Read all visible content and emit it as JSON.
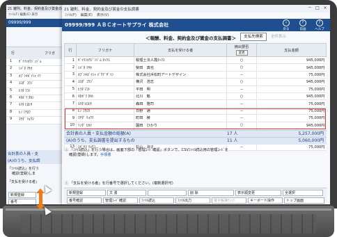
{
  "back_window": {
    "title": "21 雑則、料金、契約金及び賞金の支払調書",
    "menu": "ﾌｧｲﾙ(F)  編集(E)  表示",
    "company_code": "09999/999",
    "col_row": "行",
    "col_kana": "フリガ",
    "sum_label": "合計表の人員・支",
    "sum_label2": "(A)のうち、支払調",
    "note1": "「ﾌｧｲﾙ読込」を行う",
    "note1b": "確認(登録)しま",
    "note2": "「支払を受ける者」",
    "rows": [
      {
        "no": "1",
        "kana": "ｾﾞｲﾘｼﾎｳｼﾞﾝｼﾞﾑ"
      },
      {
        "no": "2",
        "kana": "ｼﾊﾞﾀ ﾏｻｵ"
      },
      {
        "no": "3",
        "kana": "ｶﾌﾞｼｷｶﾞｲｼｬ ｲﾜ"
      },
      {
        "no": "4",
        "kana": "ﾖｺﾀﾞ ｺｳｼﾞ"
      },
      {
        "no": "5",
        "kana": "ﾋﾗﾀ ﾏｺﾄ"
      },
      {
        "no": "6",
        "kana": "ｷﾀｶﾞﾜ ﾀｶｼ"
      },
      {
        "no": "7",
        "kana": "ﾓﾘﾀ ﾋﾛﾋｻ"
      },
      {
        "no": "8",
        "kana": "ﾋﾉ ﾐﾁﾛｳ"
      },
      {
        "no": "9",
        "kana": "ﾏﾁﾀﾞ ﾘｮｳﾏ"
      }
    ],
    "shinki": "新規登録",
    "shinki2": "番号"
  },
  "window": {
    "title": "21 雑則、料金、契約金及び賞金の支払調書",
    "menu": [
      "ﾌｧｲﾙ(F)",
      "編集(E)",
      "表示(V)"
    ],
    "min": "－",
    "max": "□",
    "close": "×"
  },
  "header": {
    "company": "09999/999 ＡＢＣオートサプライ 株式会社",
    "buttons": [
      {
        "label": "戻る",
        "icon": "‹"
      },
      {
        "label": "前画",
        "icon": "?"
      },
      {
        "label": "ヘルプ",
        "icon": "?"
      }
    ]
  },
  "screen_title": "＜報酬、料金、契約金及び賞金の支払調書＞",
  "search_button": "支払先検索",
  "all_show": "全件表示",
  "table": {
    "headers": [
      "行",
      "フリガナ",
      "支払を受ける者",
      "摘出要否",
      "支払金額"
    ],
    "change_label": "変更",
    "rows": [
      {
        "no": "1",
        "kana": "ｾﾞｲﾘｼﾎｳｼﾞﾝｼﾞﾑ ﾀｯｸｽ",
        "name": "税理士法人霞ﾀｯｸｽ",
        "flag": "○",
        "amount": "945,000円"
      },
      {
        "no": "2",
        "kana": "ｼﾊﾞﾀ ﾏｻｵ",
        "name": "柴田　真也",
        "flag": "○",
        "amount": "945,000円"
      },
      {
        "no": "3",
        "kana": "ｶﾌﾞｼｷｶﾞｲｼｬ ﾊﾞｳﾃﾞｻﾞｲﾝ",
        "name": "株式会社浜松町アートデザイン",
        "flag": "－",
        "amount": "75,000円"
      },
      {
        "no": "4",
        "kana": "ﾖｺﾀﾞ ｺｳｼﾞ",
        "name": "横沢　浩志",
        "flag": "○",
        "amount": "945,000円"
      },
      {
        "no": "5",
        "kana": "ﾋﾗﾀ ﾏｺﾄ",
        "name": "平田　明",
        "flag": "－",
        "amount": "75,000円"
      },
      {
        "no": "6",
        "kana": "ｷﾀｶﾞﾜ ﾀｶｼ",
        "name": "北川　魁",
        "flag": "○",
        "amount": "945,000円"
      },
      {
        "no": "7",
        "kana": "ﾓﾘﾀ ﾋﾛﾋｻ",
        "name": "森田　隆司",
        "flag": "－",
        "amount": "75,000円"
      },
      {
        "no": "8",
        "kana": "ﾋﾉ ﾐﾁﾛｳ",
        "name": "日野　通",
        "flag": "－",
        "amount": "75,000円"
      },
      {
        "no": "9",
        "kana": "ﾏﾁﾀﾞ ﾘｮｳﾏ",
        "name": "町田　稜",
        "flag": "－",
        "amount": "75,000円"
      },
      {
        "no": "10",
        "kana": "ｿﾉﾀﾞ ﾋｶﾘ",
        "name": "園田　ひかり",
        "flag": "○",
        "amount": "945,000円"
      },
      {
        "no": "11",
        "kana": "ｺﾔﾏ ｼﾞﾛｳ",
        "name": "小山　次郎",
        "flag": "○",
        "amount": "945,000円"
      },
      {
        "no": "12",
        "kana": "ｲｼﾀﾞ ﾕｳｼﾞ",
        "name": "石田　祐二",
        "flag": "○",
        "amount": "240,000円"
      },
      {
        "no": "13",
        "kana": "ｽｷﾞﾔﾏ ﾘｮｳｺ",
        "name": "杉山　涼子",
        "flag": "－",
        "amount": "75,000円"
      }
    ]
  },
  "summary": {
    "row1_label": "合計表の人員・支払金額の総額(A)",
    "row1_count": "17 人",
    "row1_amount": "5,257,000円",
    "row2_label": "(A)のうち、支払調書を提出するもの",
    "row2_count": "11 人",
    "row2_amount": "5,060,000円"
  },
  "notes": {
    "n1": "「ﾌｧｲﾙ読込」を行う場合は、画面下部の「管理ｺｰﾄﾞ確認」ボタンで、CSVﾌｧｲﾙ読込用の管理ｺｰﾄﾞを",
    "n1b": "確認(登録)します。",
    "n1_link": "手順書",
    "n2": "「支払を受ける者」を行番号で選択してください。(複数選択可)"
  },
  "function_keys": {
    "row1": [
      {
        "label": "新規登録",
        "dim": false
      },
      {
        "label": "文 書",
        "dim": false
      },
      {
        "label": "",
        "dim": false
      },
      {
        "label": "削 除",
        "dim": false
      },
      {
        "label": "表示順変更",
        "dim": false
      },
      {
        "label": "全選択",
        "dim": false
      }
    ],
    "row2": [
      {
        "label": "番号確認",
        "dim": false
      },
      {
        "label": "管理ｺｰﾄﾞ確認",
        "dim": false
      },
      {
        "label": "ﾌｧｲﾙ読込",
        "dim": false
      },
      {
        "label": "ﾌｧｲﾙ出力",
        "dim": false
      },
      {
        "label": "電子帳簿ﾁｪｯｸ",
        "dim": true
      },
      {
        "label": "キーボード操作",
        "dim": false
      },
      {
        "label": "トップ画面",
        "dim": false
      }
    ]
  }
}
